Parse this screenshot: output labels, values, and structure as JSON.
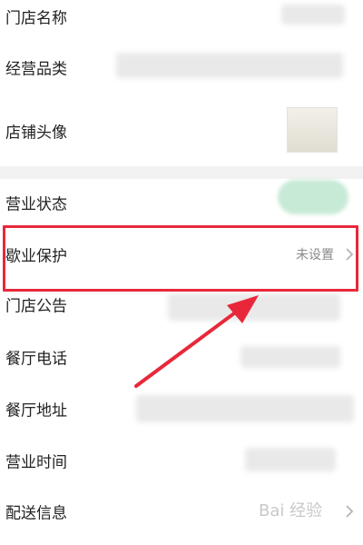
{
  "rows": {
    "store_name": {
      "label": "门店名称"
    },
    "category": {
      "label": "经营品类"
    },
    "avatar": {
      "label": "店铺头像"
    },
    "status": {
      "label": "营业状态"
    },
    "protection": {
      "label": "歇业保护",
      "value": "未设置"
    },
    "notice": {
      "label": "门店公告"
    },
    "phone": {
      "label": "餐厅电话"
    },
    "address": {
      "label": "餐厅地址"
    },
    "hours": {
      "label": "营业时间"
    },
    "delivery": {
      "label": "配送信息"
    }
  },
  "annotation": {
    "highlight_color": "#e8283a",
    "arrow_color": "#e8283a"
  },
  "watermark": {
    "text": "Bai 经验"
  },
  "icons": {
    "chevron": "chevron-right-icon",
    "arrow": "red-annotation-arrow-icon"
  }
}
